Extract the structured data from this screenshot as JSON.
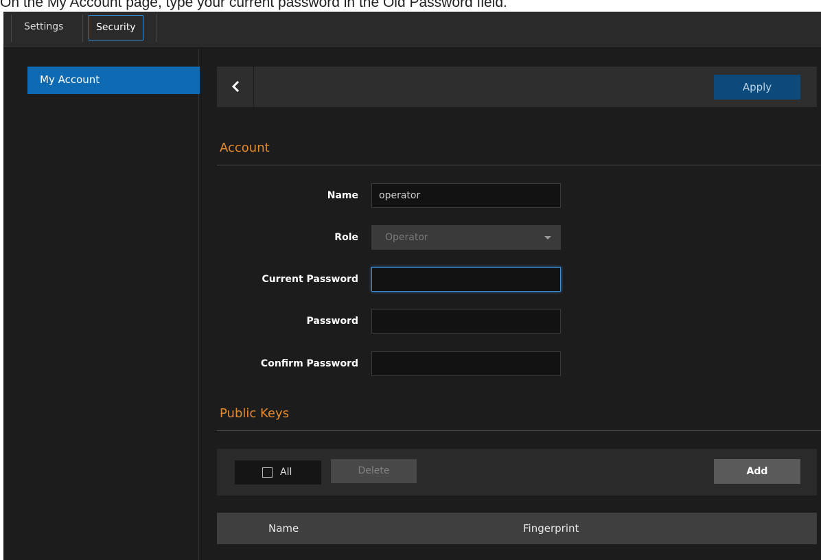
{
  "caption": "On the My Account page, type your current password in the Old Password field.",
  "tabs": [
    {
      "label": "Settings",
      "active": false
    },
    {
      "label": "Security",
      "active": true
    }
  ],
  "sidebar": {
    "items": [
      {
        "label": "My Account",
        "selected": true
      }
    ]
  },
  "toolbar": {
    "back_icon": "chevron-left-icon",
    "apply_label": "Apply"
  },
  "account": {
    "title": "Account",
    "fields": {
      "name": {
        "label": "Name",
        "value": "operator"
      },
      "role": {
        "label": "Role",
        "value": "Operator"
      },
      "current_password": {
        "label": "Current Password",
        "value": ""
      },
      "password": {
        "label": "Password",
        "value": ""
      },
      "confirm_password": {
        "label": "Confirm Password",
        "value": ""
      }
    }
  },
  "public_keys": {
    "title": "Public Keys",
    "select_all_label": "All",
    "delete_label": "Delete",
    "add_label": "Add",
    "columns": [
      "Name",
      "Fingerprint"
    ],
    "rows": []
  },
  "colors": {
    "accent_blue": "#0f6ab4",
    "section_orange": "#e58a2b",
    "background": "#1c1c1c"
  }
}
